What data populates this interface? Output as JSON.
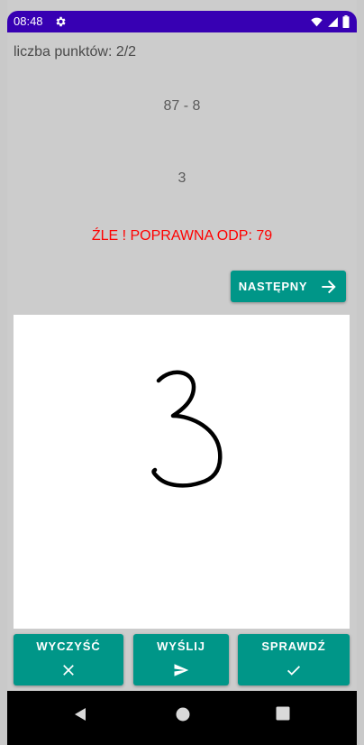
{
  "status_bar": {
    "time": "08:48",
    "background_color": "#3700b3",
    "icons": [
      "gear-icon",
      "wifi-icon",
      "signal-icon",
      "battery-icon"
    ]
  },
  "quiz": {
    "score_text": "liczba punktów: 2/2",
    "problem": "87 - 8",
    "user_answer": "3",
    "feedback": "ŹLE ! POPRAWNA ODP: 79",
    "feedback_color": "#ff0000"
  },
  "next_button": {
    "label": "NASTĘPNY",
    "icon": "arrow-right-icon"
  },
  "drawing_canvas": {
    "drawn_glyph": "3"
  },
  "actions": [
    {
      "label": "WYCZYŚĆ",
      "icon": "close-icon"
    },
    {
      "label": "WYŚLIJ",
      "icon": "send-icon"
    },
    {
      "label": "SPRAWDŹ",
      "icon": "check-icon"
    }
  ],
  "nav_bar": {
    "icons": [
      "back-icon",
      "home-icon",
      "recents-icon"
    ]
  },
  "colors": {
    "accent": "#009688",
    "app_background": "#cccccc",
    "canvas": "#ffffff"
  }
}
